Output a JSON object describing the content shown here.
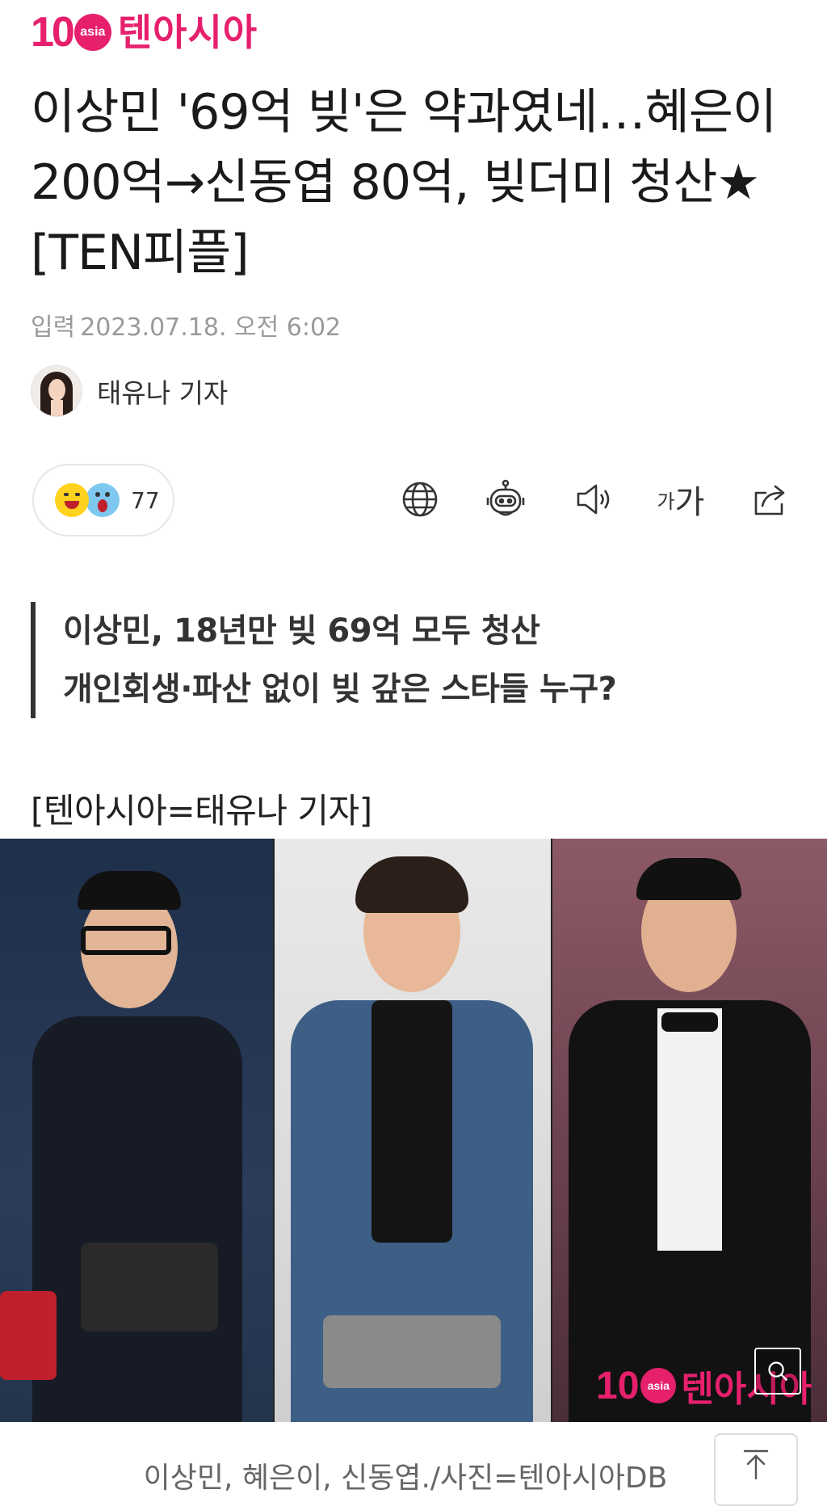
{
  "header": {
    "logo_number": "10",
    "logo_badge": "asia",
    "logo_text": "텐아시아"
  },
  "article": {
    "headline": "이상민 '69억 빚'은 약과였네…혜은이 200억→신동엽 80억, 빚더미 청산★ [TEN피플]",
    "date_label": "입력",
    "date_value": "2023.07.18. 오전 6:02",
    "author": "태유나 기자",
    "reaction_count": "77",
    "summary_lines": [
      "이상민, 18년만 빚 69억 모두 청산",
      "개인회생·파산 없이 빚 갚은 스타들 누구?"
    ],
    "byline": "[텐아시아=태유나 기자]",
    "photo_watermark_number": "10",
    "photo_watermark_badge": "asia",
    "photo_watermark_text": "텐아시아",
    "photo_caption": "이상민, 혜은이, 신동엽./사진=텐아시아DB"
  },
  "toolbar": {
    "icons": [
      "globe-icon",
      "robot-icon",
      "speaker-icon",
      "font-size-icon",
      "share-icon"
    ],
    "font_size_small": "가",
    "font_size_large": "가"
  },
  "colors": {
    "brand": "#e6206d",
    "text": "#1a1a1a",
    "muted": "#9a9a9a"
  }
}
